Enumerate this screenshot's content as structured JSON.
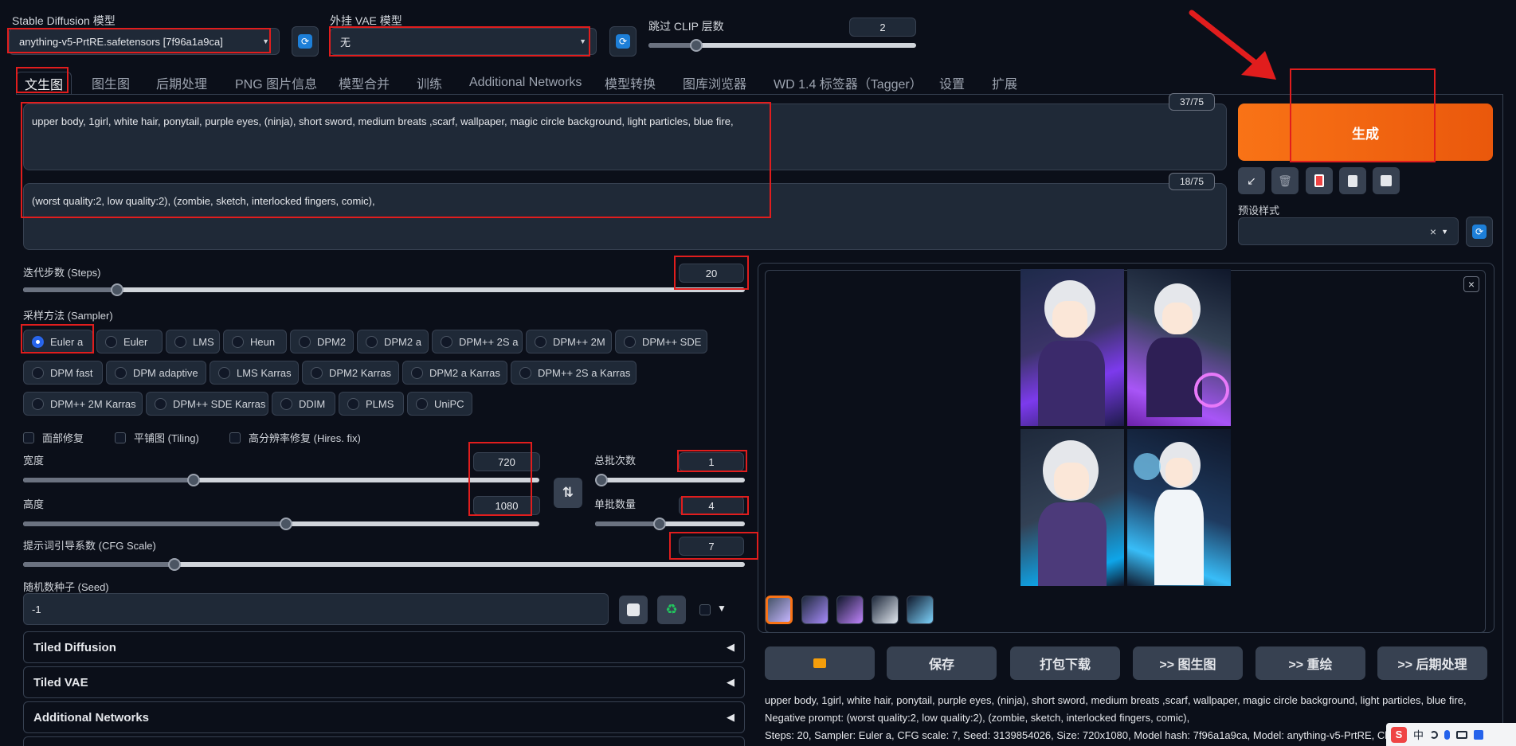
{
  "header": {
    "sd_model_label": "Stable Diffusion 模型",
    "sd_model_value": "anything-v5-PrtRE.safetensors [7f96a1a9ca]",
    "vae_label": "外挂 VAE 模型",
    "vae_value": "无",
    "clip_label": "跳过 CLIP 层数",
    "clip_value": "2",
    "clip_level": 0.18
  },
  "tabs": [
    "文生图",
    "图生图",
    "后期处理",
    "PNG 图片信息",
    "模型合并",
    "训练",
    "Additional Networks",
    "模型转换",
    "图库浏览器",
    "WD 1.4 标签器（Tagger）",
    "设置",
    "扩展"
  ],
  "prompt": {
    "positive": "upper body, 1girl, white hair, ponytail, purple eyes, (ninja), short sword, medium breats ,scarf, wallpaper, magic circle background, light particles, blue fire,",
    "positive_count": "37/75",
    "negative": "(worst quality:2, low quality:2), (zombie, sketch, interlocked fingers, comic),",
    "negative_count": "18/75"
  },
  "generate": {
    "label": "生成",
    "styles_label": "预设样式",
    "styles_clear": "×",
    "tool_icons": [
      "arrow-icon",
      "trash-icon",
      "card-icon",
      "clipboard-icon",
      "save-icon"
    ]
  },
  "steps": {
    "label": "迭代步数 (Steps)",
    "value": "20",
    "level": 0.13
  },
  "sampler": {
    "label": "采样方法 (Sampler)",
    "selected": "Euler a",
    "options": [
      "Euler a",
      "Euler",
      "LMS",
      "Heun",
      "DPM2",
      "DPM2 a",
      "DPM++ 2S a",
      "DPM++ 2M",
      "DPM++ SDE",
      "DPM fast",
      "DPM adaptive",
      "LMS Karras",
      "DPM2 Karras",
      "DPM2 a Karras",
      "DPM++ 2S a Karras",
      "DPM++ 2M Karras",
      "DPM++ SDE Karras",
      "DDIM",
      "PLMS",
      "UniPC"
    ]
  },
  "checkboxes": [
    "面部修复",
    "平铺图 (Tiling)",
    "高分辨率修复 (Hires. fix)"
  ],
  "width": {
    "label": "宽度",
    "value": "720",
    "level": 0.33
  },
  "height": {
    "label": "高度",
    "value": "1080",
    "level": 0.51
  },
  "batch_count": {
    "label": "总批次数",
    "value": "1",
    "level": 0.04
  },
  "batch_size": {
    "label": "单批数量",
    "value": "4",
    "level": 0.43
  },
  "cfg": {
    "label": "提示词引导系数 (CFG Scale)",
    "value": "7",
    "level": 0.21
  },
  "seed": {
    "label": "随机数种子 (Seed)",
    "value": "-1",
    "dropdown": "▼"
  },
  "accordions": [
    "Tiled Diffusion",
    "Tiled VAE",
    "Additional Networks"
  ],
  "output": {
    "close": "×",
    "buttons": [
      "保存",
      "打包下载",
      ">> 图生图",
      ">> 重绘",
      ">> 后期处理"
    ],
    "info_prompt": "upper body, 1girl, white hair, ponytail, purple eyes, (ninja), short sword, medium breats ,scarf, wallpaper, magic circle background, light particles, blue fire,",
    "info_negative": "Negative prompt: (worst quality:2, low quality:2), (zombie, sketch, interlocked fingers, comic),",
    "info_params": "Steps: 20, Sampler: Euler a, CFG scale: 7, Seed: 3139854026, Size: 720x1080, Model hash: 7f96a1a9ca, Model: anything-v5-PrtRE, Clip skip"
  },
  "ime": {
    "lang": "中"
  },
  "colors": {
    "accent": "#ea580c",
    "annotation": "#e11d1d",
    "selected": "#2563eb"
  }
}
